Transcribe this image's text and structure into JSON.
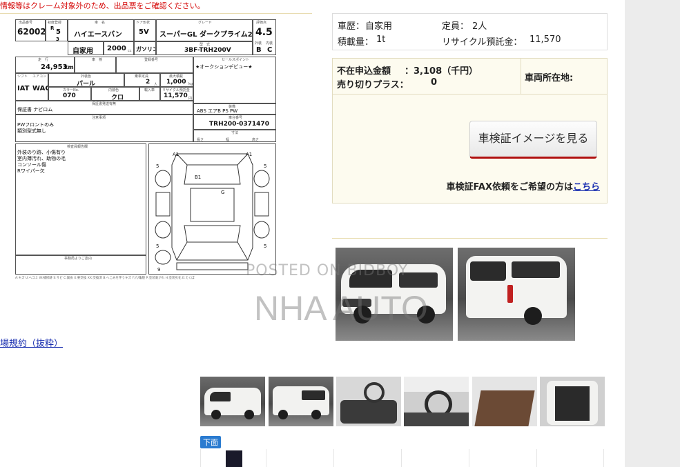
{
  "top_warning": "情報等はクレーム対象外のため、出品票をご確認ください。",
  "sheet": {
    "lot_label": "出品番号",
    "lot": "62002",
    "year_label": "初度登録",
    "year_era": "R",
    "year": "5",
    "month": "3",
    "car_name_label": "車　名",
    "car_name": "ハイエースバン",
    "doors_label": "ドア形状",
    "doors": "5V",
    "grade_label": "グレード",
    "grade": "スーパーGL ダークプライム2",
    "score_label": "評価点",
    "score": "4.5",
    "ext_label": "外装",
    "int_label": "内装",
    "ext_score": "B",
    "int_score": "C",
    "usage": "自家用",
    "displacement": "2000",
    "cc": "cc",
    "fuel": "ガソリン",
    "model_code_label": "型　式",
    "model_code": "3BF-TRH200V",
    "mileage_label": "走　行",
    "mileage": "24,953",
    "km": "km",
    "inspection_label": "車　検",
    "reg_label": "登録番号",
    "sales_point_label": "セールスポイント",
    "sales_point": "★オークションデビュー★",
    "shift_label": "シフト",
    "ac_label": "エアコン",
    "shift": "IAT",
    "ac": "WAC",
    "color_label": "外装色",
    "color": "パール",
    "capacity_label": "乗車定員",
    "capacity": "2",
    "capacity_unit": "人",
    "load_label": "最大積載",
    "load": "1,000",
    "load_unit": "kg",
    "color_code_label": "カラーNo.",
    "color_code": "070",
    "interior_label": "内装色",
    "interior": "クロ",
    "import_label": "輸入車",
    "recycle_label": "リサイクル預託金",
    "recycle": "11,570",
    "recycle_unit": "円",
    "docs_label": "保証書発送有無",
    "docs": "保証書 ナビロム",
    "equip_label": "装備",
    "equip": "ABS エアB PS PW",
    "notes_label": "注意事項",
    "notes_1": "PWフロントのみ",
    "notes_2": "類別型式無し",
    "chassis_label": "車台番号",
    "chassis": "TRH200-0371470",
    "dims_label": "寸法",
    "length": "長さ",
    "width": "幅",
    "height": "高さ",
    "inspector_label": "検査員報告欄",
    "inspector_1": "外装のり跡、小傷有り",
    "inspector_2": "室内薄汚れ、助物の毛",
    "inspector_3": "コンソール傷",
    "inspector_4": "Rワイパー欠",
    "seller_label": "事務局よりご案内",
    "mark_a1": "A1",
    "mark_b1": "B1",
    "mark_g": "G",
    "mark_5": "5",
    "mark_9": "9",
    "footer": "A:キズ U:ヘコミ W:補修跡 S:サビ C:腐食 X:要交換 XX:交換済 B:へこみを伴うキズ Y:穴/亀裂 P:塗装剥がれ H:塗装劣化 E:えくぼ"
  },
  "info": {
    "history_label": "車歴：",
    "history": "自家用",
    "capacity_label": "定員：",
    "capacity": "2人",
    "load_label": "積載量：",
    "load": "1t",
    "recycle_label": "リサイクル預託金：",
    "recycle": "11,570"
  },
  "bid": {
    "absent_label": "不在申込金額",
    "absent_value": "：3,108（千円）",
    "sellout_label": "売り切りプラス：",
    "sellout_value": "0",
    "location_label": "車両所在地:",
    "cert_button": "車検証イメージを見る",
    "fax_text": "車検証FAX依頼をご希望の方は",
    "fax_link": "こちら"
  },
  "watermark": {
    "line1": "POSTED ON BIDBOY",
    "line2": "NHA AUTO"
  },
  "rules_link": "場規約（抜粋）",
  "under_badge": "下面",
  "thumbnails": [
    "front-left",
    "rear-left",
    "interior-front",
    "dashboard",
    "cargo-floor",
    "rear-open"
  ]
}
